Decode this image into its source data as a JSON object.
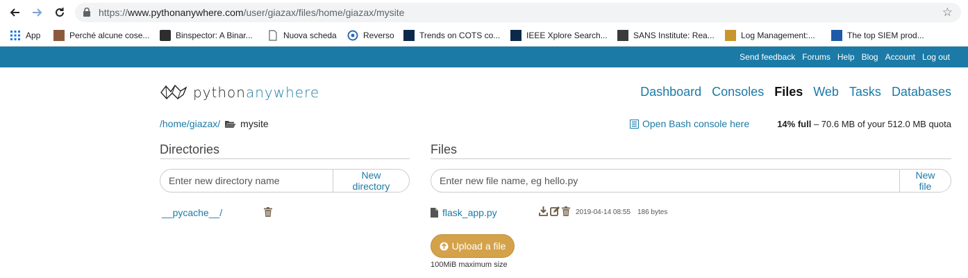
{
  "browser": {
    "url_prefix": "https://",
    "url_host": "www.pythonanywhere.com",
    "url_path": "/user/giazax/files/home/giazax/mysite",
    "bookmarks": [
      {
        "label": "App",
        "icon": "apps-grid-icon"
      },
      {
        "label": "Perché alcune cose...",
        "icon": "site-favicon"
      },
      {
        "label": "Binspector: A Binar...",
        "icon": "site-favicon"
      },
      {
        "label": "Nuova scheda",
        "icon": "page-icon"
      },
      {
        "label": "Reverso",
        "icon": "site-favicon"
      },
      {
        "label": "Trends on COTS co...",
        "icon": "ieee-favicon"
      },
      {
        "label": "IEEE Xplore Search...",
        "icon": "ieee-favicon"
      },
      {
        "label": "SANS Institute: Rea...",
        "icon": "site-favicon"
      },
      {
        "label": "Log Management:...",
        "icon": "site-favicon"
      },
      {
        "label": "The top SIEM prod...",
        "icon": "site-favicon"
      }
    ]
  },
  "topbar": {
    "links": [
      "Send feedback",
      "Forums",
      "Help",
      "Blog",
      "Account",
      "Log out"
    ]
  },
  "header": {
    "logo_part1": "python",
    "logo_part2": "anywhere",
    "nav": [
      {
        "label": "Dashboard",
        "active": false
      },
      {
        "label": "Consoles",
        "active": false
      },
      {
        "label": "Files",
        "active": true
      },
      {
        "label": "Web",
        "active": false
      },
      {
        "label": "Tasks",
        "active": false
      },
      {
        "label": "Databases",
        "active": false
      }
    ]
  },
  "breadcrumb": {
    "path_link": "/home/giazax/",
    "current": "mysite"
  },
  "bash_link": "Open Bash console here",
  "quota": {
    "percent": "14% full",
    "sep": "–",
    "used": "70.6 MB",
    "rest": "of your 512.0 MB quota"
  },
  "directories": {
    "title": "Directories",
    "placeholder": "Enter new directory name",
    "button": "New directory",
    "items": [
      "__pycache__/"
    ]
  },
  "files": {
    "title": "Files",
    "placeholder": "Enter new file name, eg hello.py",
    "button": "New file",
    "items": [
      {
        "name": "flask_app.py",
        "date": "2019-04-14 08:55",
        "size": "186 bytes"
      }
    ]
  },
  "upload": {
    "button": "Upload a file",
    "note": "100MiB maximum size"
  },
  "colors": {
    "brand": "#1b7aa6",
    "upload": "#d4a24a"
  }
}
